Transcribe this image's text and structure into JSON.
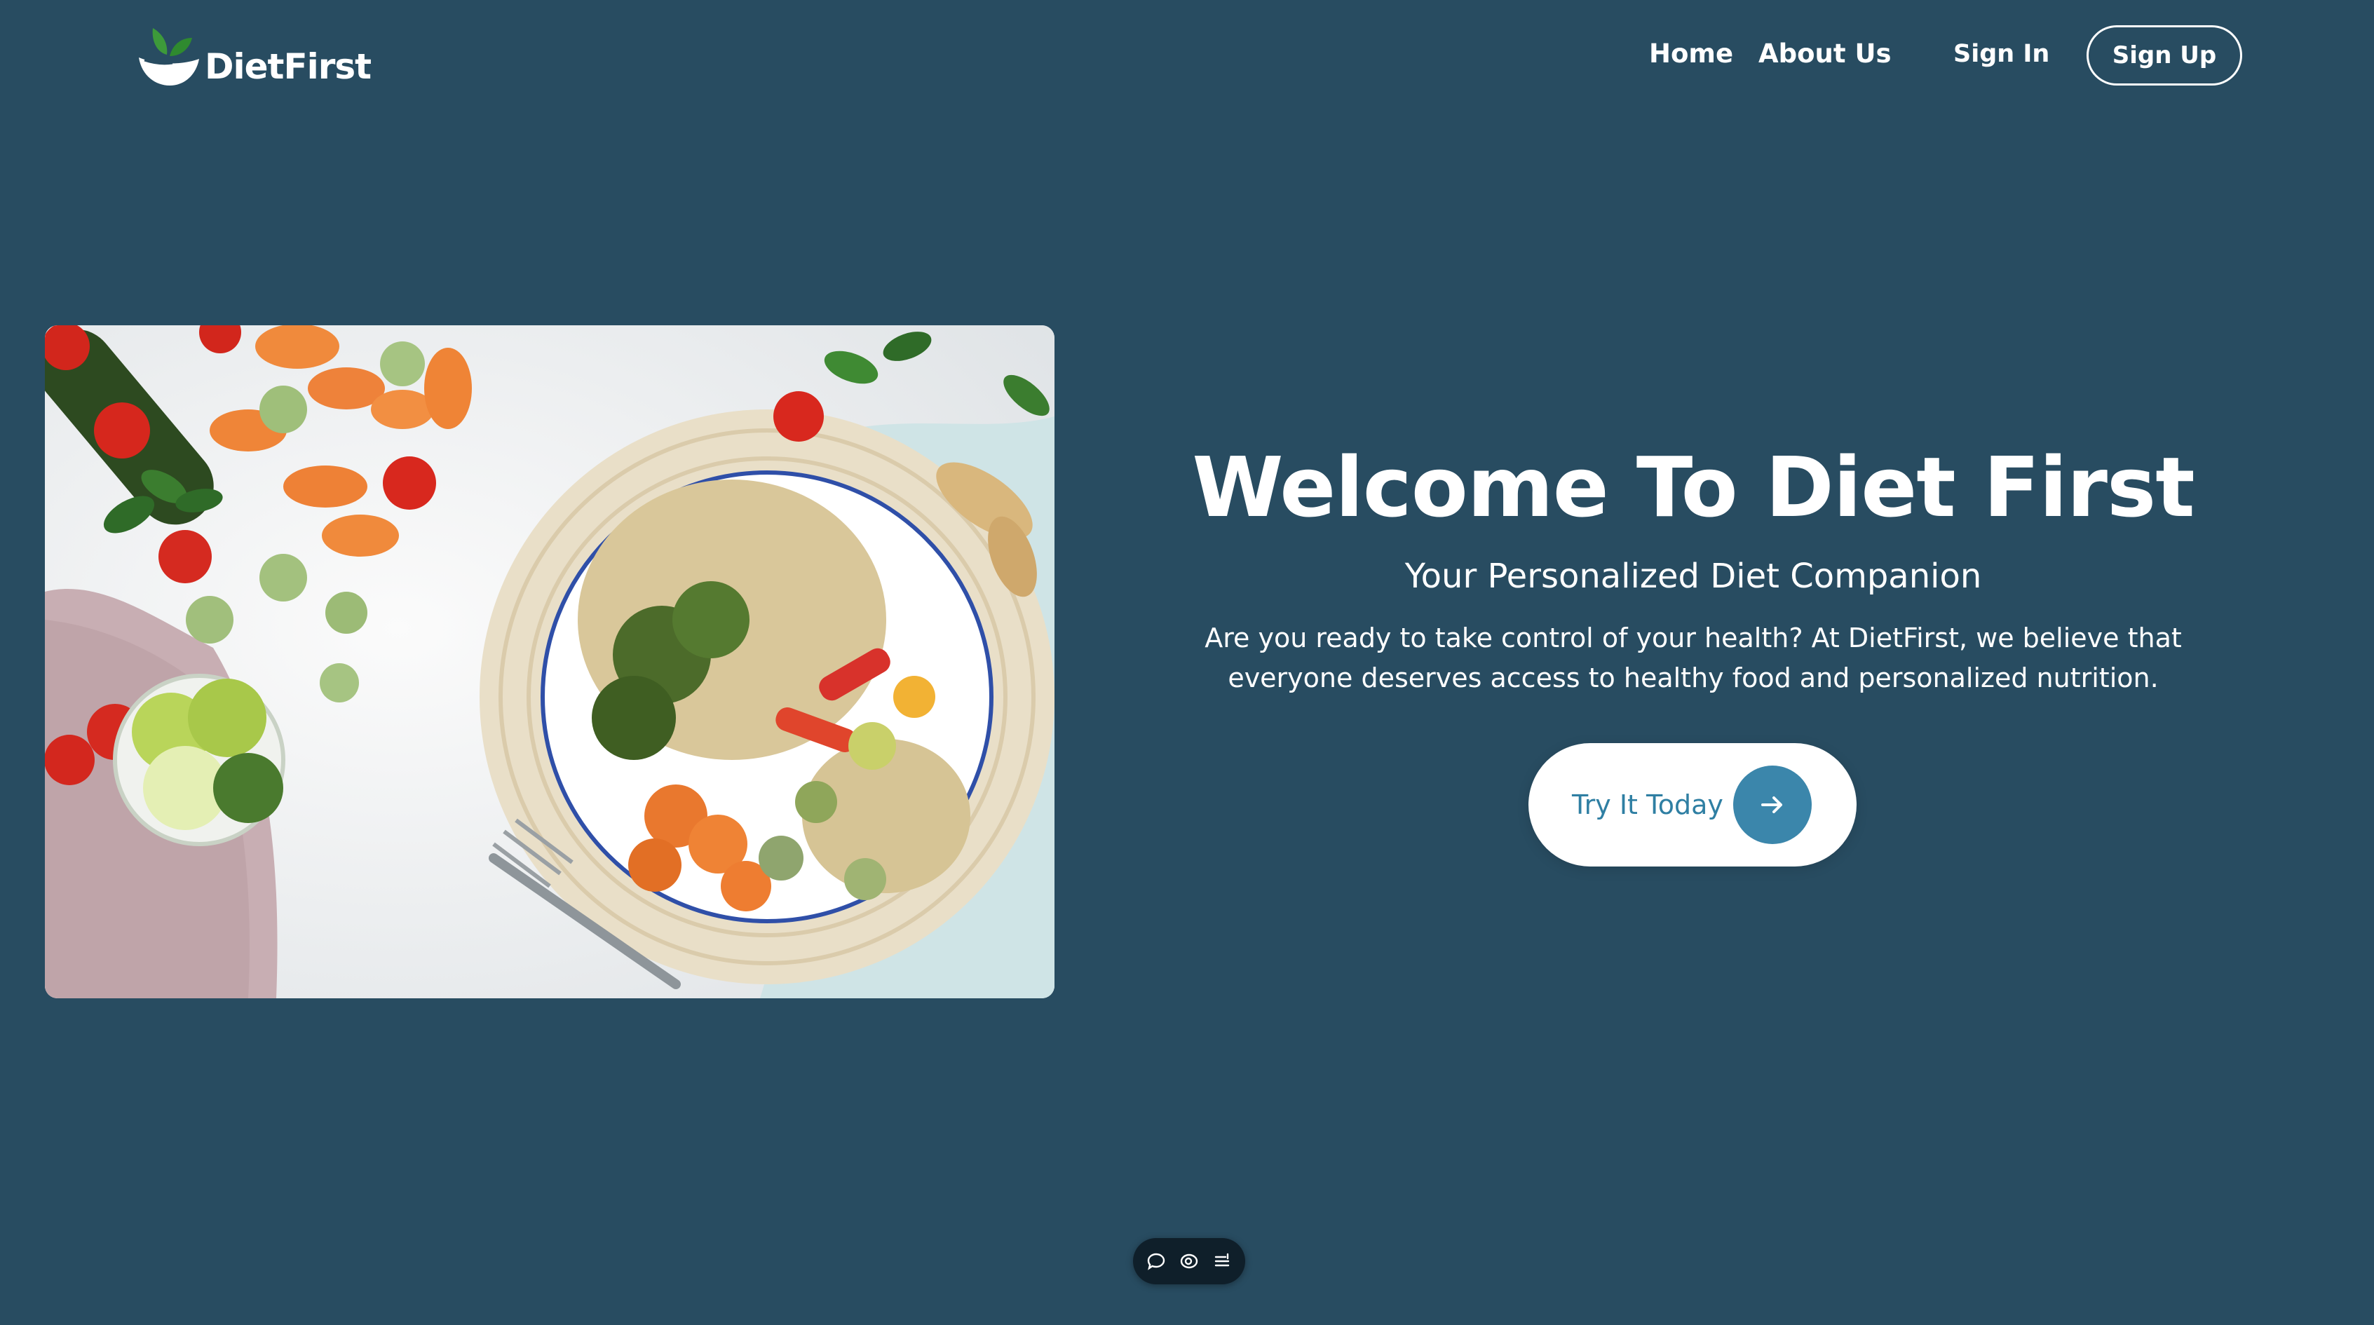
{
  "brand": {
    "name": "DietFirst",
    "logo_icon": "leaf-bowl-icon"
  },
  "nav": {
    "home": "Home",
    "about": "About Us",
    "sign_in": "Sign In",
    "sign_up": "Sign Up"
  },
  "hero": {
    "title": "Welcome To Diet First",
    "subtitle": "Your Personalized Diet Companion",
    "description": "Are you ready to take control of your health? At DietFirst, we believe that everyone deserves access to healthy food and personalized nutrition.",
    "cta_label": "Try It Today",
    "cta_icon": "arrow-right-icon",
    "image_icon": "food-bowl-photo"
  },
  "toolbar": {
    "icons": [
      "comment-icon",
      "eye-icon",
      "list-icon"
    ]
  },
  "colors": {
    "background": "#284c61",
    "accent": "#3b86ab",
    "cta_text": "#2f7fa3",
    "logo_green": "#3d9a3a"
  }
}
